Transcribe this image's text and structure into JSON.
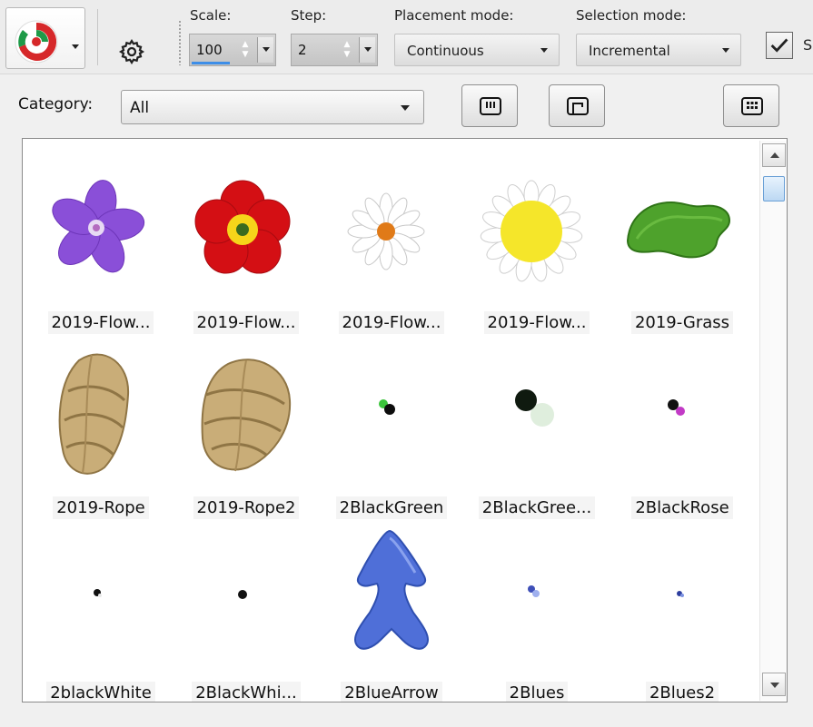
{
  "toolbar": {
    "tool_icon": "picture-tube-swirl-icon",
    "settings_icon": "gear-icon",
    "scale_label": "Scale:",
    "scale_value": "100",
    "step_label": "Step:",
    "step_value": "2",
    "placement_label": "Placement mode:",
    "placement_value": "Continuous",
    "selection_label": "Selection mode:",
    "selection_value": "Incremental",
    "checkbox_checked": true,
    "checkbox_label": "S"
  },
  "category": {
    "label": "Category:",
    "value": "All"
  },
  "view_buttons": [
    {
      "icon": "strip-view-icon"
    },
    {
      "icon": "window-view-icon"
    },
    {
      "icon": "grid-view-icon"
    }
  ],
  "grid": {
    "items": [
      {
        "label": "2019-Flow...",
        "thumb": "purple-flower"
      },
      {
        "label": "2019-Flow...",
        "thumb": "red-primrose"
      },
      {
        "label": "2019-Flow...",
        "thumb": "white-daisy"
      },
      {
        "label": "2019-Flow...",
        "thumb": "yellow-daisy"
      },
      {
        "label": "2019-Grass",
        "thumb": "grass-patch"
      },
      {
        "label": "2019-Rope",
        "thumb": "rope-knot"
      },
      {
        "label": "2019-Rope2",
        "thumb": "rope-knot"
      },
      {
        "label": "2BlackGreen",
        "thumb": "black-green-dots"
      },
      {
        "label": "2BlackGree...",
        "thumb": "black-green-large-dots"
      },
      {
        "label": "2BlackRose",
        "thumb": "black-rose-dots"
      },
      {
        "label": "2blackWhite",
        "thumb": "black-white-dot"
      },
      {
        "label": "2BlackWhi...",
        "thumb": "black-dot"
      },
      {
        "label": "2BlueArrow",
        "thumb": "blue-arrow"
      },
      {
        "label": "2Blues",
        "thumb": "blue-dots"
      },
      {
        "label": "2Blues2",
        "thumb": "blue-dots-small"
      }
    ]
  },
  "colors": {
    "scroll_accent": "#3d8ee8",
    "panel_bg": "#ffffff",
    "window_bg": "#f0f0f0"
  }
}
